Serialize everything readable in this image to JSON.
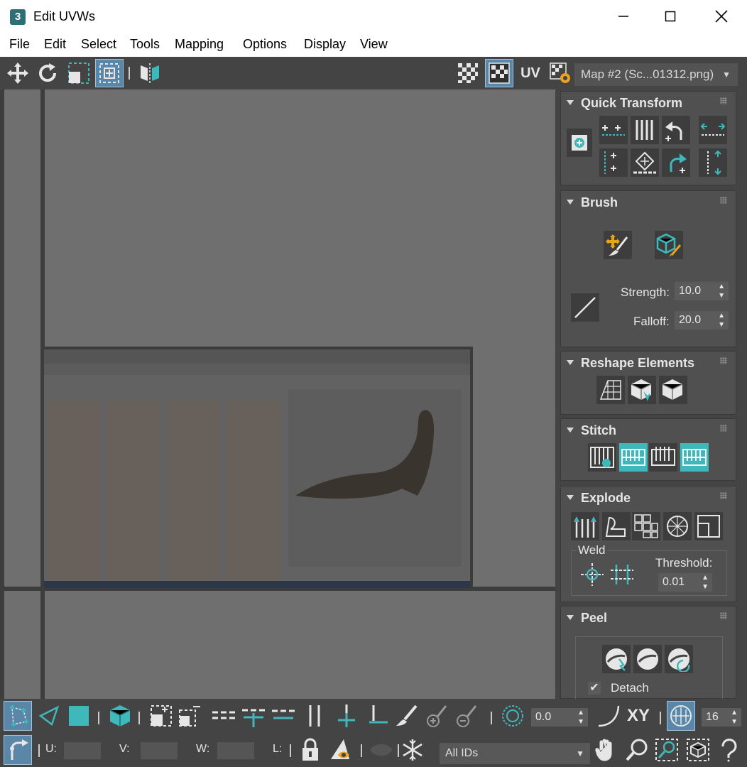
{
  "window": {
    "app_icon": "3",
    "title": "Edit UVWs"
  },
  "menu": [
    "File",
    "Edit",
    "Select",
    "Tools",
    "Mapping",
    "Options",
    "Display",
    "View"
  ],
  "toolbar": {
    "uv_label": "UV",
    "map_dropdown": "Map #2 (Sc...01312.png)"
  },
  "panels": {
    "quick_transform": {
      "title": "Quick Transform"
    },
    "brush": {
      "title": "Brush",
      "strength_label": "Strength:",
      "strength_value": "10.0",
      "falloff_label": "Falloff:",
      "falloff_value": "20.0"
    },
    "reshape": {
      "title": "Reshape Elements"
    },
    "stitch": {
      "title": "Stitch"
    },
    "explode": {
      "title": "Explode",
      "weld_label": "Weld",
      "threshold_label": "Threshold:",
      "threshold_value": "0.01"
    },
    "peel": {
      "title": "Peel",
      "detach_label": "Detach",
      "detach_checked": true
    }
  },
  "bottom": {
    "angle_value": "0.0",
    "xy_label": "XY",
    "grid_value": "16",
    "u_label": "U:",
    "v_label": "V:",
    "w_label": "W:",
    "l_label": "L:",
    "ids_dropdown": "All IDs"
  },
  "colors": {
    "accent": "#3fb8bb",
    "selected": "#5a87a8",
    "background": "#444444",
    "viewport": "#6f6f6f"
  }
}
